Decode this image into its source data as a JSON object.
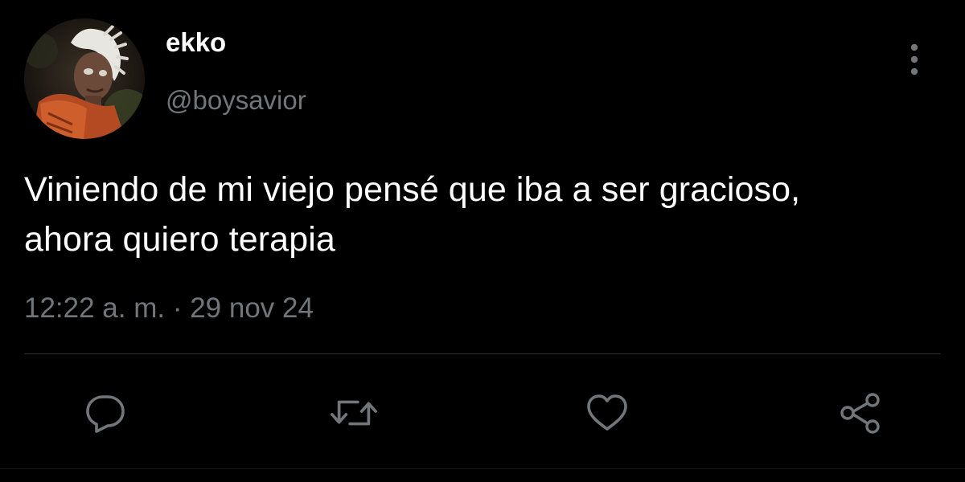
{
  "author": {
    "display_name": "ekko",
    "handle": "@boysavior"
  },
  "tweet": {
    "text": "Viniendo de mi viejo pensé que iba a ser gracioso,\nahora quiero terapia",
    "timestamp": "12:22 a. m. · 29 nov 24"
  },
  "icons": {
    "more": "more-vertical-icon",
    "reply": "reply-icon",
    "retweet": "retweet-icon",
    "like": "heart-icon",
    "share": "share-icon"
  },
  "colors": {
    "background": "#000000",
    "primary_text": "#ffffff",
    "secondary_text": "#71767b",
    "divider": "#2f3336",
    "icon": "#71767b"
  }
}
